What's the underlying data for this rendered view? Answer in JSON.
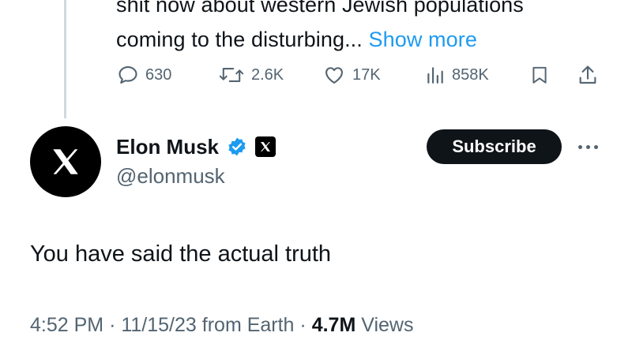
{
  "parent_tweet": {
    "text_line1": "shit now about western Jewish populations",
    "text_line2": "coming to the disturbing...",
    "show_more_label": "Show more",
    "stats": {
      "replies": "630",
      "reposts": "2.6K",
      "likes": "17K",
      "views": "858K"
    }
  },
  "tweet": {
    "author_name": "Elon Musk",
    "handle": "@elonmusk",
    "subscribe_label": "Subscribe",
    "text": "You have said the actual truth",
    "time": "4:52 PM",
    "separator": "·",
    "date": "11/15/23",
    "source": "from Earth",
    "views_count": "4.7M",
    "views_label": "Views"
  },
  "colors": {
    "accent": "#1d9bf0",
    "text_primary": "#0f1419",
    "text_secondary": "#536471",
    "thread_line": "#cfd9de"
  },
  "icons": [
    "reply-icon",
    "repost-icon",
    "like-icon",
    "views-icon",
    "bookmark-icon",
    "share-icon",
    "verified-badge-icon",
    "x-logo-icon",
    "more-options-icon"
  ]
}
